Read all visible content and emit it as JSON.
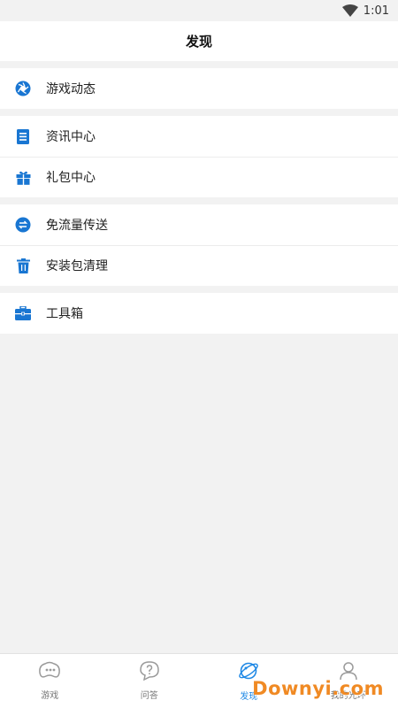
{
  "status_bar": {
    "time": "1:01"
  },
  "header": {
    "title": "发现"
  },
  "menu_groups": [
    {
      "items": [
        {
          "label": "游戏动态",
          "icon": "camera-shutter-icon"
        }
      ]
    },
    {
      "items": [
        {
          "label": "资讯中心",
          "icon": "document-icon"
        },
        {
          "label": "礼包中心",
          "icon": "gift-icon"
        }
      ]
    },
    {
      "items": [
        {
          "label": "免流量传送",
          "icon": "transfer-icon"
        },
        {
          "label": "安装包清理",
          "icon": "trash-icon"
        }
      ]
    },
    {
      "items": [
        {
          "label": "工具箱",
          "icon": "toolbox-icon"
        }
      ]
    }
  ],
  "tab_bar": {
    "tabs": [
      {
        "label": "游戏",
        "icon": "gamepad-icon",
        "active": false
      },
      {
        "label": "问答",
        "icon": "question-icon",
        "active": false
      },
      {
        "label": "发现",
        "icon": "planet-icon",
        "active": true
      },
      {
        "label": "我的光环",
        "icon": "user-icon",
        "active": false
      }
    ]
  },
  "watermark": {
    "text": "Downyi.com"
  },
  "colors": {
    "accent": "#1e88e5",
    "icon_blue": "#1976d2",
    "watermark": "#f08a24"
  }
}
